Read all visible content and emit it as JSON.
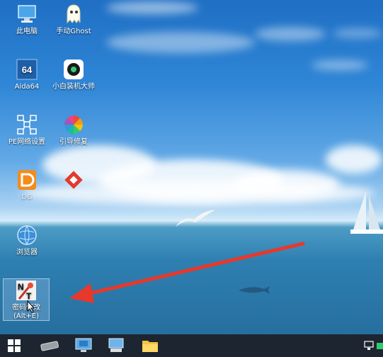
{
  "desktop": {
    "icons": [
      {
        "label": "此电脑",
        "icon": "this-pc-icon"
      },
      {
        "label": "手动Ghost",
        "icon": "ghost-icon"
      },
      {
        "label": "Aida64",
        "icon": "aida64-icon"
      },
      {
        "label": "小白装机大师",
        "icon": "xiaobai-installer-icon"
      },
      {
        "label": "PE网络设置",
        "icon": "network-settings-icon"
      },
      {
        "label": "引导修复",
        "icon": "boot-repair-icon"
      },
      {
        "label": "DG",
        "icon": "diskgenius-icon"
      },
      {
        "label": "",
        "icon": "anydesk-icon"
      },
      {
        "label": "浏览器",
        "icon": "browser-icon"
      },
      {
        "label": "密码修改",
        "sub": "(Alt+E)",
        "icon": "ntpwedit-password-icon"
      }
    ]
  },
  "taskbar": {
    "items": [
      "start-button",
      "disk-tool",
      "remote-desktop",
      "device-manager",
      "file-explorer"
    ],
    "tray": [
      "network-icon",
      "battery-icon"
    ]
  },
  "colors": {
    "arrow": "#e8382b",
    "taskbar": "#1c2530"
  }
}
